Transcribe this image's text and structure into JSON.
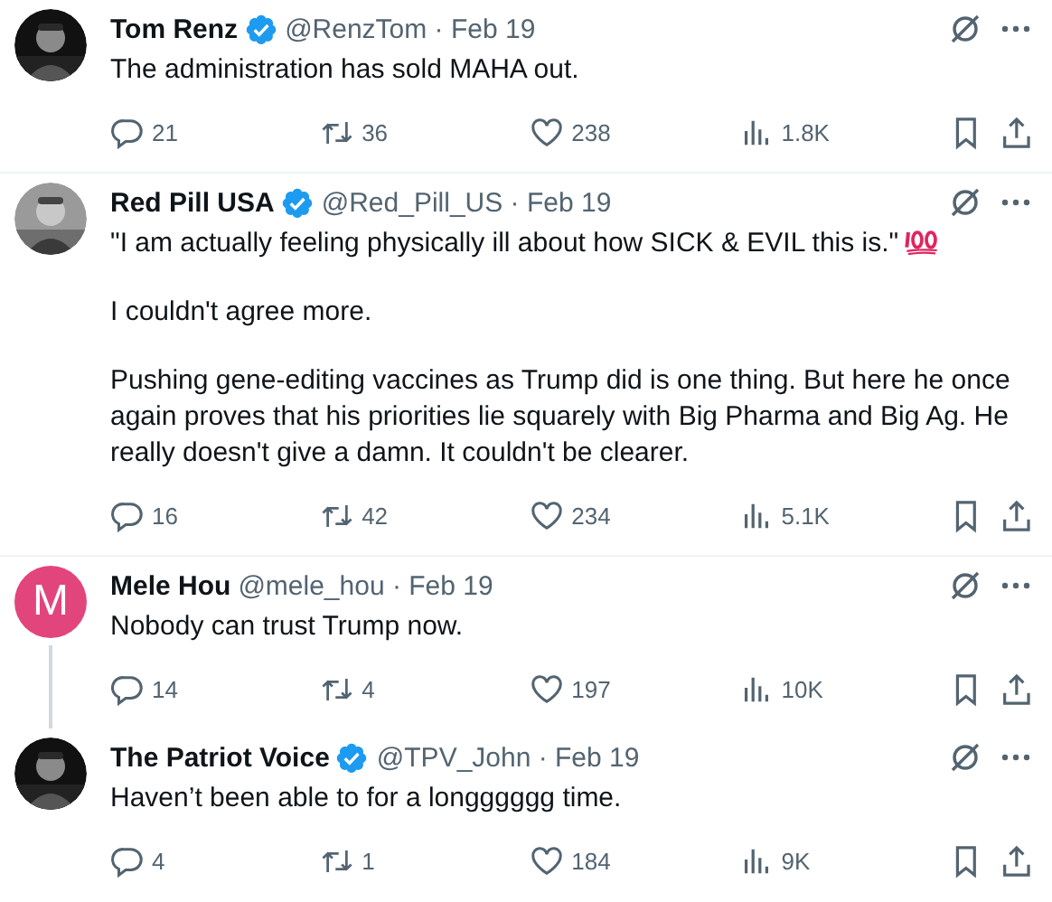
{
  "tweets": [
    {
      "avatar": {
        "kind": "picture"
      },
      "name": "Tom Renz",
      "verified": true,
      "byline": "@RenzTom · Feb 19",
      "thread_line": false,
      "divider": true,
      "paragraphs": [
        {
          "text": "The administration has sold MAHA out."
        }
      ],
      "replies": "21",
      "reposts": "36",
      "likes": "238",
      "views": "1.8K"
    },
    {
      "avatar": {
        "kind": "picture"
      },
      "name": "Red Pill USA",
      "verified": true,
      "byline": "@Red_Pill_US · Feb 19",
      "thread_line": false,
      "divider": true,
      "paragraphs": [
        {
          "text": "\"I am actually feeling physically ill about how SICK & EVIL this is.\"",
          "hundred_points_emoji": true
        },
        {
          "text": "I couldn't agree more."
        },
        {
          "text": "Pushing gene-editing vaccines as Trump did is one thing. But here he once again proves that his priorities lie squarely with Big Pharma and Big Ag. He really doesn't give a damn. It couldn't be clearer."
        }
      ],
      "replies": "16",
      "reposts": "42",
      "likes": "234",
      "views": "5.1K"
    },
    {
      "avatar": {
        "kind": "letter",
        "letter": "M",
        "color": "#e2457c"
      },
      "name": "Mele Hou",
      "verified": false,
      "byline": "@mele_hou · Feb 19",
      "thread_line": true,
      "divider": false,
      "paragraphs": [
        {
          "text": "Nobody can trust Trump now."
        }
      ],
      "replies": "14",
      "reposts": "4",
      "likes": "197",
      "views": "10K"
    },
    {
      "avatar": {
        "kind": "picture"
      },
      "name": "The Patriot Voice",
      "verified": true,
      "byline": "@TPV_John · Feb 19",
      "thread_line": false,
      "divider": false,
      "paragraphs": [
        {
          "text": "Haven’t been able to for a longggggg time."
        }
      ],
      "replies": "4",
      "reposts": "1",
      "likes": "184",
      "views": "9K"
    }
  ]
}
